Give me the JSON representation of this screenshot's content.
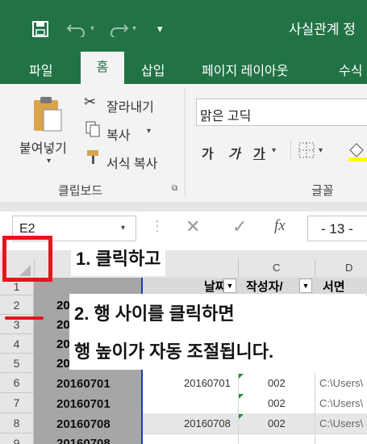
{
  "titlebar": {
    "save_icon": "save-icon",
    "undo_icon": "undo-icon",
    "redo_icon": "redo-icon",
    "customize_icon": "customize-qat-icon",
    "title": "사실관계 정"
  },
  "tabs": [
    "파일",
    "홈",
    "삽입",
    "페이지 레이아웃",
    "수식"
  ],
  "ribbon": {
    "paste_label": "붙여넣기",
    "cut_label": "잘라내기",
    "copy_label": "복사",
    "format_painter_label": "서식 복사",
    "clipboard_group": "클립보드",
    "font_name": "맑은 고딕",
    "bold": "가",
    "italic": "가",
    "underline": "가",
    "font_group": "글꼴"
  },
  "formula_bar": {
    "name_box": "E2",
    "cancel_icon": "cancel-icon",
    "enter_icon": "enter-icon",
    "fx": "fx",
    "value": "- 13 -"
  },
  "sheet": {
    "columns": [
      "C",
      "D"
    ],
    "headers": [
      "날짜",
      "작성자/",
      "서면"
    ],
    "rows": [
      {
        "num": "1",
        "a": "",
        "b": "",
        "c": "",
        "d": ""
      },
      {
        "num": "2",
        "a": "20",
        "b": "",
        "c": "",
        "d": ""
      },
      {
        "num": "3",
        "a": "20",
        "b": "",
        "c": "",
        "d": ""
      },
      {
        "num": "4",
        "a": "20",
        "b": "",
        "c": "",
        "d": ""
      },
      {
        "num": "5",
        "a": "20",
        "b": "",
        "c": "",
        "d": ""
      },
      {
        "num": "6",
        "a": "20160701",
        "b": "20160701",
        "c": "002",
        "d": "C:\\Users\\"
      },
      {
        "num": "7",
        "a": "20160701",
        "b": "",
        "c": "002",
        "d": "C:\\Users\\"
      },
      {
        "num": "8",
        "a": "20160708",
        "b": "20160708",
        "c": "002",
        "d": "C:\\Users\\"
      },
      {
        "num": "9",
        "a": "20160708",
        "b": "",
        "c": "",
        "d": ""
      }
    ]
  },
  "annotations": {
    "step1": "1. 클릭하고",
    "step2_line1": "2. 행 사이를 클릭하면",
    "step2_line2": "행 높이가 자동 조절됩니다."
  },
  "colors": {
    "excel_green": "#217346",
    "highlight_red": "#e8141b"
  }
}
